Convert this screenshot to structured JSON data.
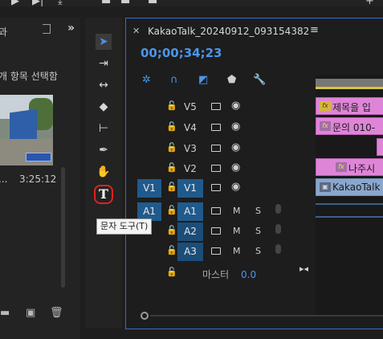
{
  "left_panel": {
    "header_text": "과",
    "selection_text": "개 항목 선택함",
    "clip_name_fragment": "...",
    "clip_duration": "3:25:12"
  },
  "tools": {
    "tooltip": "문자 도구(T)"
  },
  "timeline": {
    "tab_title": "KakaoTalk_20240912_093154382",
    "timecode": "00;00;34;23",
    "video_tracks": [
      {
        "name": "V5"
      },
      {
        "name": "V4"
      },
      {
        "name": "V3"
      },
      {
        "name": "V2"
      },
      {
        "name": "V1",
        "source": "V1"
      }
    ],
    "audio_tracks": [
      {
        "name": "A1",
        "source": "A1",
        "mute": "M",
        "solo": "S"
      },
      {
        "name": "A2",
        "mute": "M",
        "solo": "S"
      },
      {
        "name": "A3",
        "mute": "M",
        "solo": "S"
      }
    ],
    "master": {
      "label": "마스터",
      "value": "0.0"
    },
    "clips": {
      "v5_text": "제목을 입",
      "v4_text": "문의 010-",
      "v2_text": "나주시",
      "v1_text": "KakaoTalk",
      "fx_label": "fx"
    }
  },
  "colors": {
    "accent_blue": "#4b96ea",
    "track_target": "#205a8c",
    "clip_pink": "#df85d8",
    "clip_blue": "#8aa6cc",
    "highlight_red": "#e02020"
  }
}
